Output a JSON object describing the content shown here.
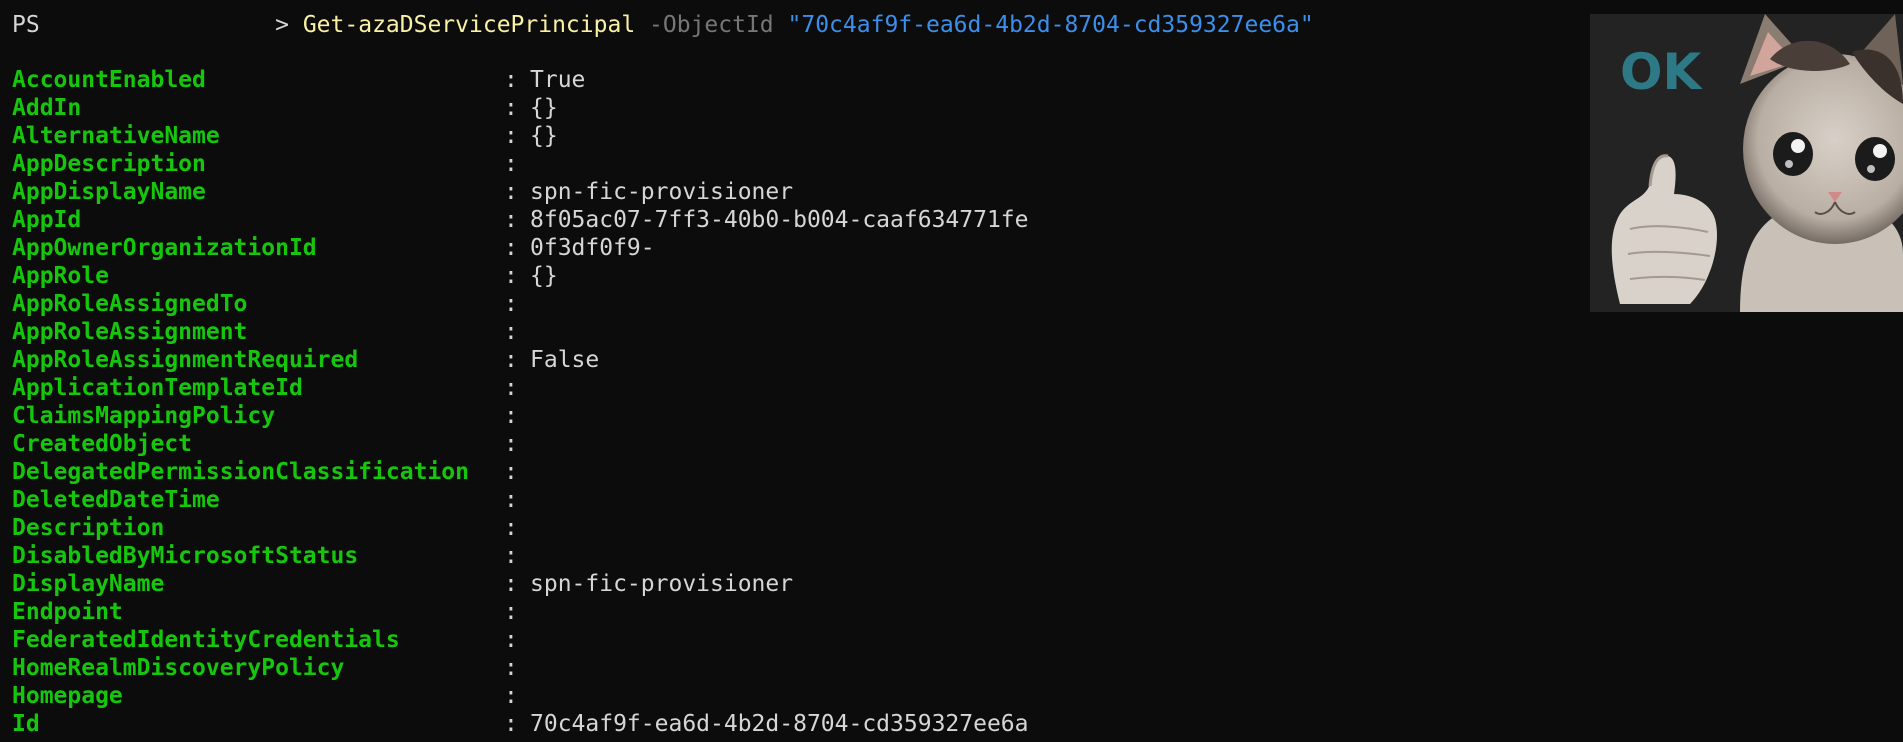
{
  "prompt": {
    "ps": "PS",
    "gt": ">",
    "cmdlet": "Get-azaDServicePrincipal",
    "param": "-ObjectId",
    "value": "\"70c4af9f-ea6d-4b2d-8704-cd359327ee6a\""
  },
  "separator": ":",
  "properties": [
    {
      "name": "AccountEnabled",
      "value": "True"
    },
    {
      "name": "AddIn",
      "value": "{}"
    },
    {
      "name": "AlternativeName",
      "value": "{}"
    },
    {
      "name": "AppDescription",
      "value": ""
    },
    {
      "name": "AppDisplayName",
      "value": "spn-fic-provisioner"
    },
    {
      "name": "AppId",
      "value": "8f05ac07-7ff3-40b0-b004-caaf634771fe"
    },
    {
      "name": "AppOwnerOrganizationId",
      "value": "0f3df0f9-"
    },
    {
      "name": "AppRole",
      "value": "{}"
    },
    {
      "name": "AppRoleAssignedTo",
      "value": ""
    },
    {
      "name": "AppRoleAssignment",
      "value": ""
    },
    {
      "name": "AppRoleAssignmentRequired",
      "value": "False"
    },
    {
      "name": "ApplicationTemplateId",
      "value": ""
    },
    {
      "name": "ClaimsMappingPolicy",
      "value": ""
    },
    {
      "name": "CreatedObject",
      "value": ""
    },
    {
      "name": "DelegatedPermissionClassification",
      "value": ""
    },
    {
      "name": "DeletedDateTime",
      "value": ""
    },
    {
      "name": "Description",
      "value": ""
    },
    {
      "name": "DisabledByMicrosoftStatus",
      "value": ""
    },
    {
      "name": "DisplayName",
      "value": "spn-fic-provisioner"
    },
    {
      "name": "Endpoint",
      "value": ""
    },
    {
      "name": "FederatedIdentityCredentials",
      "value": ""
    },
    {
      "name": "HomeRealmDiscoveryPolicy",
      "value": ""
    },
    {
      "name": "Homepage",
      "value": ""
    },
    {
      "name": "Id",
      "value": "70c4af9f-ea6d-4b2d-8704-cd359327ee6a"
    }
  ],
  "sticker": {
    "text": "OK",
    "icon": "thumbs-up-cat-icon"
  },
  "colors": {
    "background": "#0c0c0c",
    "property": "#16c60c",
    "value": "#d6d6d6",
    "cmdlet": "#f9f1a5",
    "parameter": "#767676",
    "string": "#3b8eea"
  }
}
